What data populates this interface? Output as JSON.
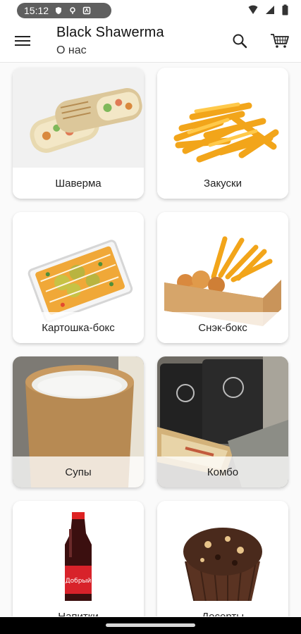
{
  "status": {
    "time": "15:12"
  },
  "header": {
    "title": "Black Shawerma",
    "subtitle": "О нас"
  },
  "categories": [
    {
      "label": "Шаверма"
    },
    {
      "label": "Закуски"
    },
    {
      "label": "Картошка-бокс"
    },
    {
      "label": "Снэк-бокс"
    },
    {
      "label": "Супы"
    },
    {
      "label": "Комбо"
    },
    {
      "label": "Напитки"
    },
    {
      "label": "Десерты"
    }
  ],
  "drink_label_text": "Добрый",
  "colors": {
    "accent": "#111111",
    "card_bg": "#ffffff",
    "page_bg": "#fafafa"
  }
}
